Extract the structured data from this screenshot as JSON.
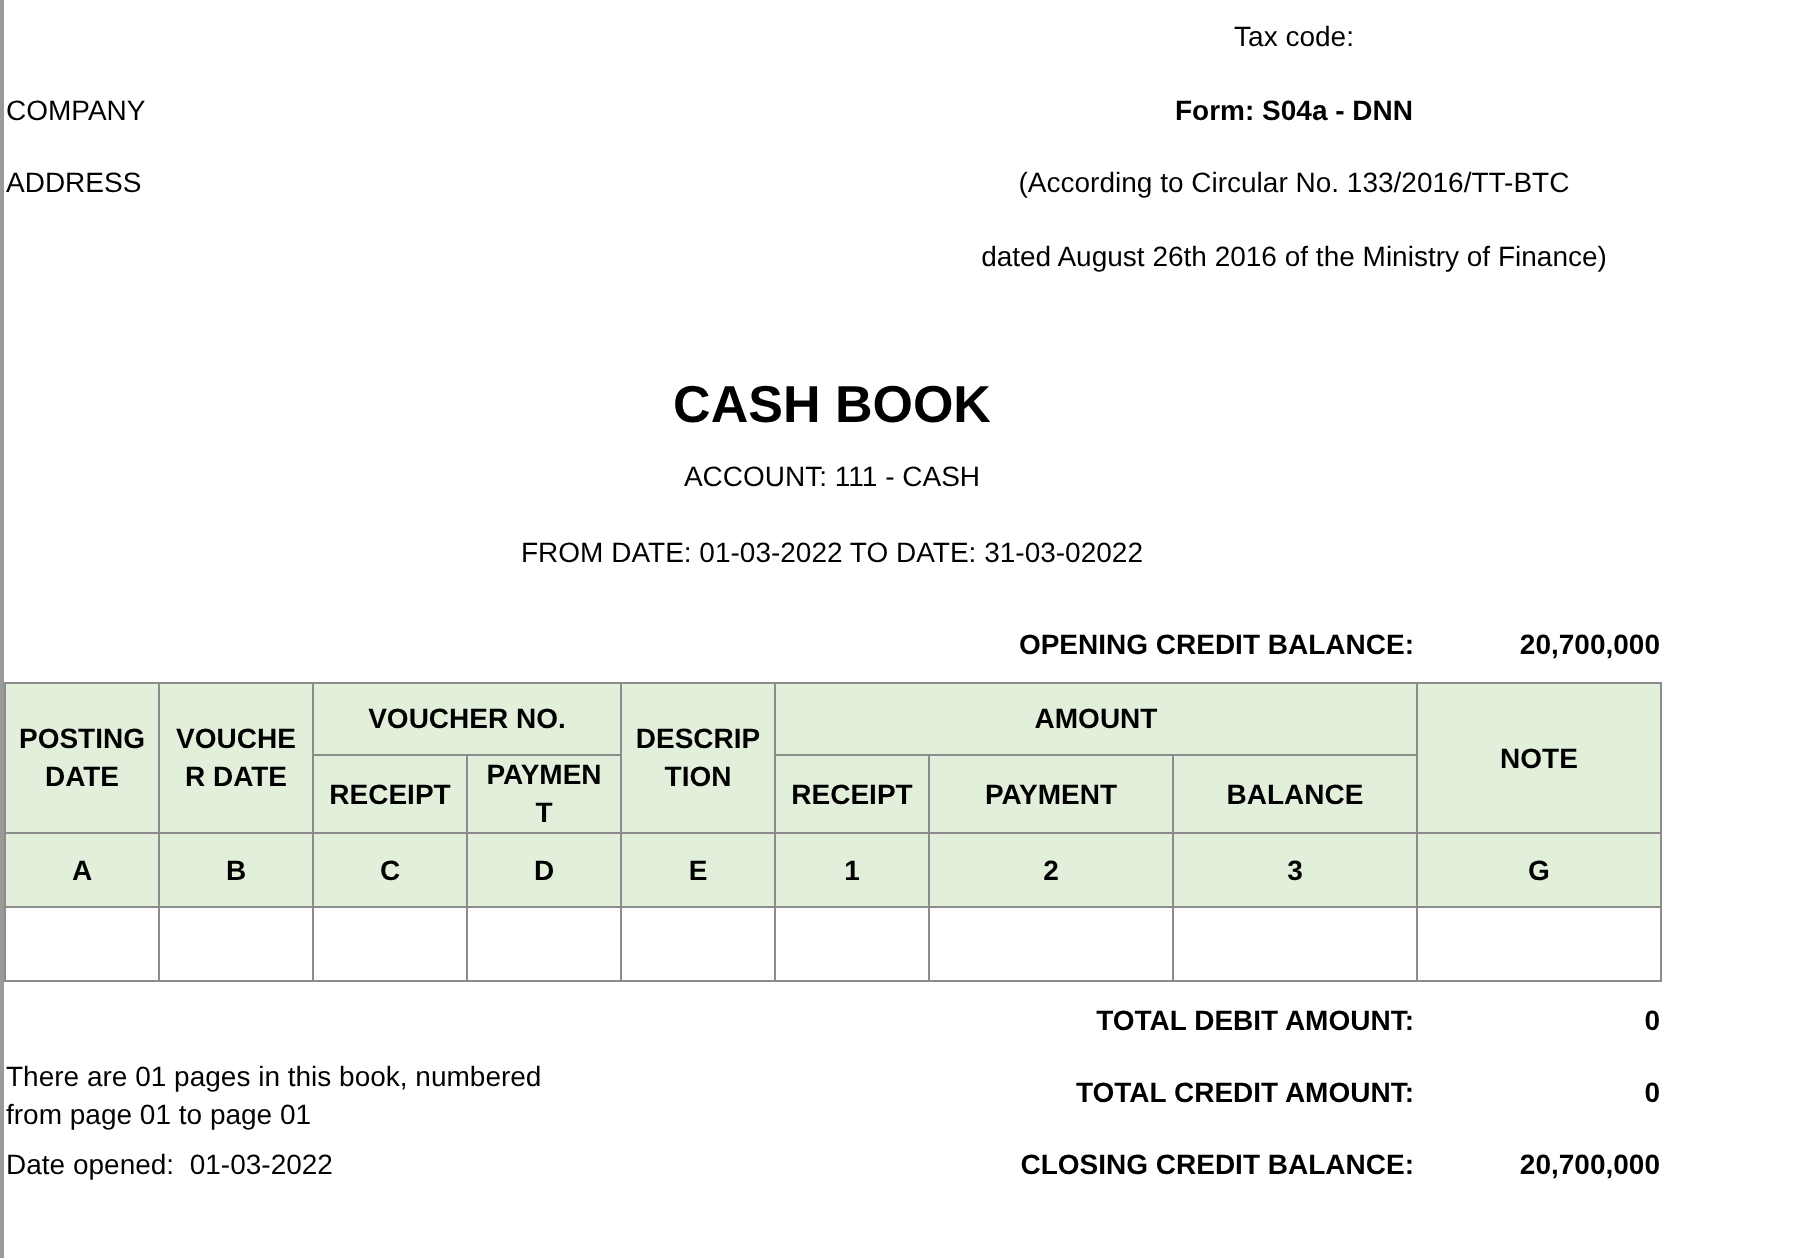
{
  "header": {
    "tax_code": "Tax code:",
    "company": "COMPANY",
    "address": "ADDRESS",
    "form": "Form: S04a - DNN",
    "circular": "(According to Circular No. 133/2016/TT-BTC",
    "dated": "dated August 26th 2016 of the Ministry of Finance)"
  },
  "title": "CASH BOOK",
  "account": "ACCOUNT: 111 - CASH",
  "period": "FROM DATE: 01-03-2022 TO DATE: 31-03-02022",
  "opening": {
    "label": "OPENING CREDIT BALANCE:",
    "value": "20,700,000"
  },
  "table": {
    "columns": [
      {
        "kind": "single",
        "label": "POSTING DATE",
        "code": "A"
      },
      {
        "kind": "single",
        "label": "VOUCHER DATE",
        "code": "B"
      },
      {
        "kind": "group",
        "label": "VOUCHER NO.",
        "children": [
          {
            "label": "RECEIPT",
            "code": "C"
          },
          {
            "label": "PAYMENT",
            "code": "D"
          }
        ]
      },
      {
        "kind": "single",
        "label": "DESCRIPTION",
        "code": "E"
      },
      {
        "kind": "group",
        "label": "AMOUNT",
        "children": [
          {
            "label": "RECEIPT",
            "code": "1"
          },
          {
            "label": "PAYMENT",
            "code": "2"
          },
          {
            "label": "BALANCE",
            "code": "3"
          }
        ]
      },
      {
        "kind": "single",
        "label": "NOTE",
        "code": "G"
      }
    ]
  },
  "totals": [
    {
      "label": "TOTAL DEBIT AMOUNT:",
      "value": "0"
    },
    {
      "label": "TOTAL CREDIT AMOUNT:",
      "value": "0"
    },
    {
      "label": "CLOSING CREDIT BALANCE:",
      "value": "20,700,000"
    }
  ],
  "pages_note": "There are 01 pages in this book, numbered from page 01 to page 01",
  "date_opened": "Date opened:  01-03-2022"
}
